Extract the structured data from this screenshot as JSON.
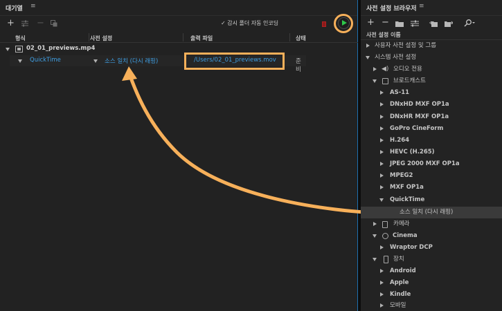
{
  "queue": {
    "title": "대기열",
    "menu_icon": "≡",
    "toolbar": {
      "add": "+",
      "remove": "−",
      "auto_encode_check": "✓",
      "auto_encode_label": "감시 폴더 자동 인코딩"
    },
    "columns": {
      "format": "형식",
      "preset": "사전 설정",
      "output": "출력 파일",
      "status": "상태"
    },
    "file": {
      "name": "02_01_previews.mp4"
    },
    "job": {
      "format": "QuickTime",
      "preset": "소스 일치 (다시 래핑)",
      "output": "/Users/02_01_previews.mov",
      "status": "준비"
    }
  },
  "browser": {
    "title": "사전 설정 브라우저",
    "menu_icon": "≡",
    "column_name": "사전 설정 이름",
    "items": [
      {
        "label": "사용자 사전 설정 및 그룹"
      },
      {
        "label": "시스템 사전 설정"
      },
      {
        "label": "오디오 전용"
      },
      {
        "label": "브로드캐스트"
      },
      {
        "label": "AS-11"
      },
      {
        "label": "DNxHD MXF OP1a"
      },
      {
        "label": "DNxHR MXF OP1a"
      },
      {
        "label": "GoPro CineForm"
      },
      {
        "label": "H.264"
      },
      {
        "label": "HEVC (H.265)"
      },
      {
        "label": "JPEG 2000 MXF OP1a"
      },
      {
        "label": "MPEG2"
      },
      {
        "label": "MXF OP1a"
      },
      {
        "label": "QuickTime"
      },
      {
        "label": "소스 일치 (다시 래핑)"
      },
      {
        "label": "카메라"
      },
      {
        "label": "Cinema"
      },
      {
        "label": "Wraptor DCP"
      },
      {
        "label": "장치"
      },
      {
        "label": "Android"
      },
      {
        "label": "Apple"
      },
      {
        "label": "Kindle"
      },
      {
        "label": "모바일"
      }
    ]
  },
  "colors": {
    "accent_link": "#3f9fe4",
    "highlight_orange": "#f7b05a",
    "start_green": "#2ec84a",
    "stop_red": "#8d1a1a"
  }
}
